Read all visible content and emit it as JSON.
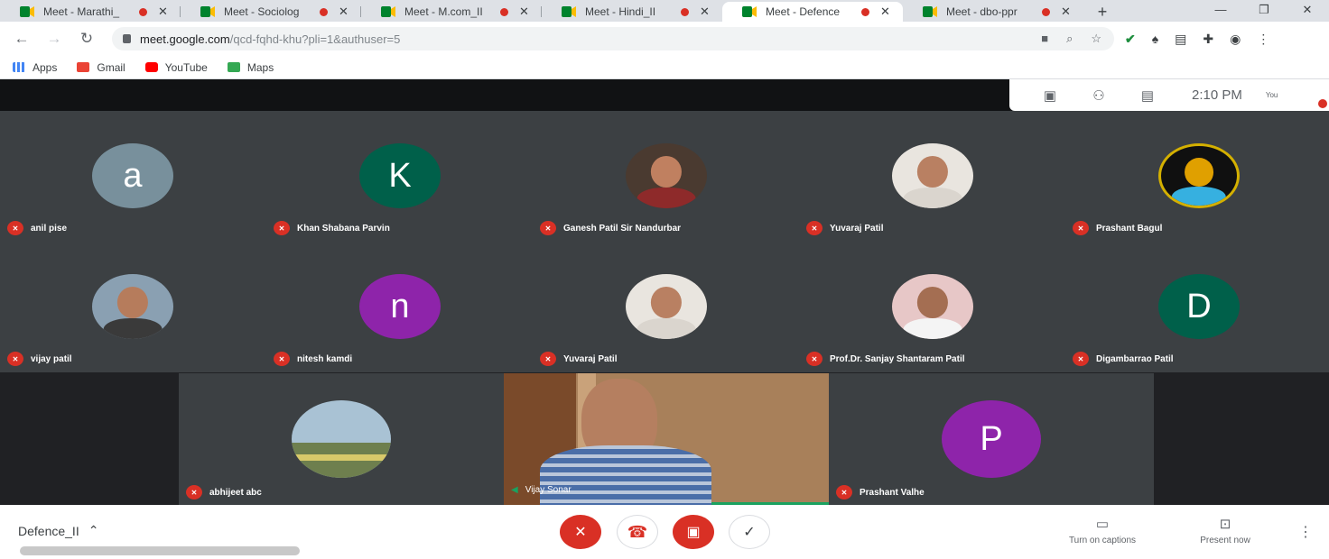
{
  "browser": {
    "tabs": [
      {
        "title": "Meet - Marathi_",
        "active": false
      },
      {
        "title": "Meet - Sociolog",
        "active": false
      },
      {
        "title": "Meet - M.com_II",
        "active": false
      },
      {
        "title": "Meet - Hindi_II",
        "active": false
      },
      {
        "title": "Meet - Defence",
        "active": true
      },
      {
        "title": "Meet - dbo-ppr",
        "active": false
      }
    ],
    "new_tab": "+",
    "window_controls": {
      "minimize": "—",
      "restore": "❐",
      "close": "✕"
    },
    "url_host": "meet.google.com",
    "url_path": "/qcd-fqhd-khu?pli=1&authuser=5",
    "bookmarks": [
      {
        "label": "Apps",
        "icon": "apps-grid-icon",
        "color": "#ea4335"
      },
      {
        "label": "Gmail",
        "icon": "gmail-icon",
        "color": "#ea4335"
      },
      {
        "label": "YouTube",
        "icon": "youtube-icon",
        "color": "#ff0000"
      },
      {
        "label": "Maps",
        "icon": "maps-icon",
        "color": "#34a853"
      }
    ]
  },
  "meet": {
    "clock": "2:10 PM",
    "you_label": "You",
    "meeting_name": "Defence_II",
    "participants": [
      {
        "name": "anil pise",
        "type": "letter",
        "letter": "a",
        "color": "#78909c"
      },
      {
        "name": "Khan Shabana Parvin",
        "type": "letter",
        "letter": "K",
        "color": "#00604a"
      },
      {
        "name": "Ganesh Patil Sir Nandurbar",
        "type": "photo",
        "bg": "#4a3a30",
        "face": "#c08060",
        "body": "#8e2a2a"
      },
      {
        "name": "Yuvaraj Patil",
        "type": "photo",
        "bg": "#e9e5df",
        "face": "#b98062",
        "body": "#dad5ce"
      },
      {
        "name": "Prashant Bagul",
        "type": "photo",
        "bg": "#101010",
        "face": "#e0a000",
        "body": "#36b0e0"
      },
      {
        "name": "vijay patil",
        "type": "photo",
        "bg": "#8aa0b2",
        "face": "#b67c5c",
        "body": "#3a3a3a"
      },
      {
        "name": "nitesh kamdi",
        "type": "letter",
        "letter": "n",
        "color": "#8e24aa"
      },
      {
        "name": "Yuvaraj Patil",
        "type": "photo",
        "bg": "#e9e5df",
        "face": "#b98062",
        "body": "#dad5ce"
      },
      {
        "name": "Prof.Dr. Sanjay Shantaram Patil",
        "type": "photo",
        "bg": "#e7c7c7",
        "face": "#a46e52",
        "body": "#f4f4f4"
      },
      {
        "name": "Digambarrao Patil",
        "type": "letter",
        "letter": "D",
        "color": "#00604a"
      },
      {
        "name": "abhijeet abc",
        "type": "photo",
        "bg": "#a9c2d4",
        "face": "#9fa3a8",
        "body": "#6e7f4e"
      },
      {
        "name": "Prashant Valhe",
        "type": "letter",
        "letter": "P",
        "color": "#8e24aa"
      }
    ],
    "presenter": {
      "name": "Vijay Sonar"
    },
    "controls": {
      "mic": "mic-off-icon",
      "hangup": "hangup-icon",
      "camera": "camera-off-icon",
      "more_options": "check-icon"
    },
    "captions_label": "Turn on captions",
    "present_label": "Present now"
  }
}
